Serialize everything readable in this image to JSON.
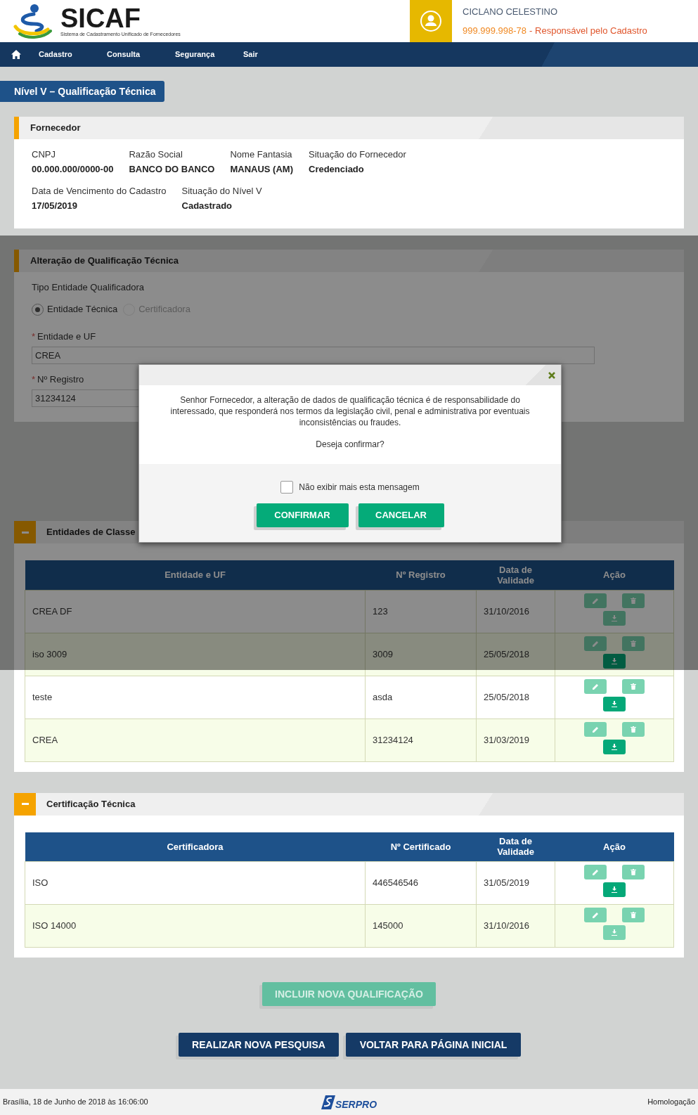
{
  "header": {
    "logo_title": "SICAF",
    "logo_subtitle": "Sistema de Cadastramento Unificado de Fornecedores",
    "user_name": "CICLANO CELESTINO",
    "user_cpf": "999.999.998-78",
    "user_role": "- Responsável pelo Cadastro"
  },
  "nav": {
    "items": [
      "Cadastro",
      "Consulta",
      "Segurança",
      "Sair"
    ]
  },
  "level_tab": "Nível V – Qualificação Técnica",
  "supplier": {
    "title": "Fornecedor",
    "rows": [
      [
        {
          "label": "CNPJ",
          "value": "00.000.000/0000-00"
        },
        {
          "label": "Razão Social",
          "value": "BANCO DO BANCO"
        },
        {
          "label": "Nome Fantasia",
          "value": "MANAUS (AM)"
        },
        {
          "label": "Situação do Fornecedor",
          "value": "Credenciado"
        }
      ],
      [
        {
          "label": "Data de Vencimento do Cadastro",
          "value": "17/05/2019"
        },
        {
          "label": "Situação do Nível V",
          "value": "Cadastrado"
        }
      ]
    ]
  },
  "edit_form": {
    "title": "Alteração de Qualificação Técnica",
    "type_label": "Tipo Entidade Qualificadora",
    "radios": [
      {
        "label": "Entidade Técnica",
        "selected": true,
        "disabled": false
      },
      {
        "label": "Certificadora",
        "selected": false,
        "disabled": true
      }
    ],
    "fields": [
      {
        "mark": "*",
        "label": "Entidade e UF",
        "value": "CREA"
      },
      {
        "mark": "*",
        "label": "Nº Registro",
        "value": "31234124"
      }
    ]
  },
  "entities": {
    "title": "Entidades de Classe",
    "expanded": true,
    "columns": [
      "Entidade e UF",
      "Nº Registro",
      "Data de Validade",
      "Ação"
    ],
    "rows": [
      {
        "cells": [
          "CREA DF",
          "123",
          "31/10/2016"
        ],
        "download_active": false
      },
      {
        "cells": [
          "iso 3009",
          "3009",
          "25/05/2018"
        ],
        "download_active": true
      },
      {
        "cells": [
          "teste",
          "asda",
          "25/05/2018"
        ],
        "download_active": true
      },
      {
        "cells": [
          "CREA",
          "31234124",
          "31/03/2019"
        ],
        "download_active": true
      }
    ]
  },
  "certifications": {
    "title": "Certificação Técnica",
    "expanded": true,
    "columns": [
      "Certificadora",
      "Nº Certificado",
      "Data de Validade",
      "Ação"
    ],
    "rows": [
      {
        "cells": [
          "ISO",
          "446546546",
          "31/05/2019"
        ],
        "download_active": true
      },
      {
        "cells": [
          "ISO 14000",
          "145000",
          "31/10/2016"
        ],
        "download_active": false
      }
    ]
  },
  "actions": {
    "include": {
      "label": "INCLUIR NOVA QUALIFICAÇÃO",
      "disabled": true
    },
    "buttons": [
      "REALIZAR NOVA PESQUISA",
      "VOLTAR PARA PÁGINA INICIAL"
    ]
  },
  "modal": {
    "message": "Senhor Fornecedor, a alteração de dados de qualificação técnica é de responsabilidade do interessado, que responderá nos termos da legislação civil, penal e administrativa por eventuais inconsistências ou fraudes.",
    "question": "Deseja confirmar?",
    "checkbox": {
      "label": "Não exibir mais esta mensagem",
      "checked": false
    },
    "buttons": [
      "CONFIRMAR",
      "CANCELAR"
    ]
  },
  "footer": {
    "left": "Brasília, 18 de Junho de 2018 às 16:06:00",
    "logo": "SERPRO",
    "right": "Homologação"
  }
}
